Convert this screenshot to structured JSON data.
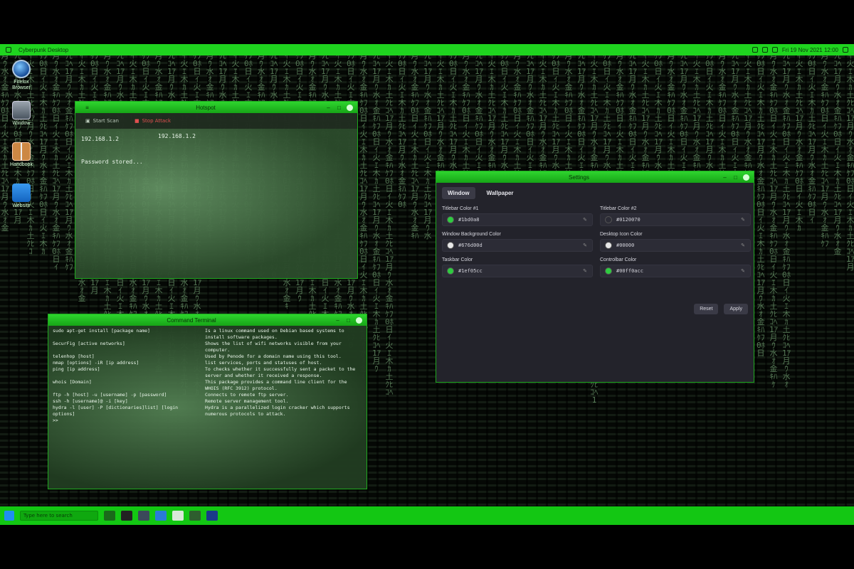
{
  "top_panel": {
    "title": "Cyberpunk Desktop",
    "clock": "Fri 19 Nov 2021 12:00"
  },
  "desktop_icons": [
    {
      "label": "Firefox Browser",
      "icon": "browser-icon"
    },
    {
      "label": "Window",
      "icon": "window-icon"
    },
    {
      "label": "Handbook",
      "icon": "book-icon"
    },
    {
      "label": "Website",
      "icon": "web-icon"
    }
  ],
  "net_window": {
    "title": "Hotspot",
    "toolbar": {
      "start": "Start Scan",
      "stop": "Stop Attack"
    },
    "ip_left": "192.168.1.2",
    "ip_right": "192.168.1.2",
    "status": "Password stored..."
  },
  "settings": {
    "title": "Settings",
    "tabs": [
      "Window",
      "Wallpaper"
    ],
    "fields": [
      {
        "label": "Titlebar Color #1",
        "value": "#1bd0a8",
        "swatch": "#2ecc40"
      },
      {
        "label": "Titlebar Color #2",
        "value": "#0120070",
        "swatch": "#2c2c36"
      },
      {
        "label": "Window Background Color",
        "value": "#676d00d",
        "swatch": "#e8e8e8"
      },
      {
        "label": "Desktop Icon Color",
        "value": "#00000",
        "swatch": "#e8e8e8"
      },
      {
        "label": "Taskbar Color",
        "value": "#1ef05cc",
        "swatch": "#2ecc40"
      },
      {
        "label": "Controlbar Color",
        "value": "#00ff0acc",
        "swatch": "#2ecc40"
      }
    ],
    "reset": "Reset",
    "apply": "Apply"
  },
  "terminal": {
    "title": "Command Terminal",
    "rows": [
      {
        "cmd": "sudo apt-get install [package name]",
        "desc": "Is a linux command used on Debian based systems to install software packages."
      },
      {
        "cmd": "SecurFig [active networks]",
        "desc": "Shows the list of wifi networks visible from your computer."
      },
      {
        "cmd": "telenhop [host]",
        "desc": "Used by Penode for a domain name using this tool."
      },
      {
        "cmd": "nmap [options] -iR [ip address]",
        "desc": "list services, ports and statuses of host."
      },
      {
        "cmd": "ping [ip address]",
        "desc": "To checks whether it successfully sent a packet to the server and whether it received a response."
      },
      {
        "cmd": "whois [Domain]",
        "desc": "This package provides a command line client for the WHOIS (RFC 3912) protocol."
      },
      {
        "cmd": "ftp -h [host] -u [username] -p [password]",
        "desc": "Connects to remote ftp server."
      },
      {
        "cmd": "ssh -h [username]@ -i [key]",
        "desc": "Remote server management tool."
      },
      {
        "cmd": "hydra -l [user] -P [dictionaries]list] [login options]",
        "desc": "Hydra is a parallelized login cracker which supports numerous protocols to attack."
      },
      {
        "cmd": ">>",
        "desc": ""
      }
    ]
  },
  "taskbar": {
    "search_placeholder": "Type here to search"
  }
}
